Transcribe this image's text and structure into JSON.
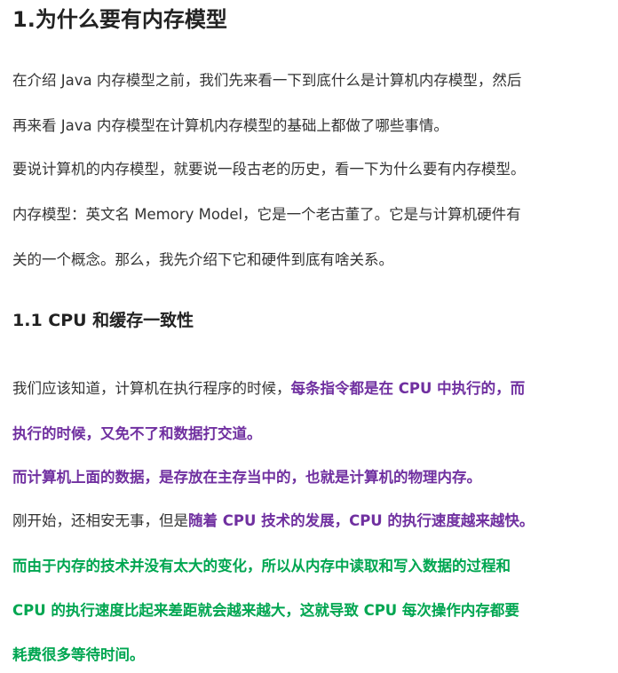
{
  "section": {
    "title": "1.为什么要有内存模型"
  },
  "paragraphs": {
    "p1_l1": "在介绍 Java 内存模型之前，我们先来看一下到底什么是计算机内存模型，然后",
    "p1_l2": "再来看 Java 内存模型在计算机内存模型的基础上都做了哪些事情。",
    "p2": "要说计算机的内存模型，就要说一段古老的历史，看一下为什么要有内存模型。",
    "p3_l1": "内存模型：英文名 Memory Model，它是一个老古董了。它是与计算机硬件有",
    "p3_l2": "关的一个概念。那么，我先介绍下它和硬件到底有啥关系。"
  },
  "subsection": {
    "title": "1.1 CPU  和缓存一致性"
  },
  "sub_paragraphs": {
    "s1_l1_plain": "我们应该知道，计算机在执行程序的时候，",
    "s1_l1_purple": "每条指令都是在 CPU 中执行的，而",
    "s1_l2_purple": "执行的时候，又免不了和数据打交道。",
    "s2_purple": "而计算机上面的数据，是存放在主存当中的，也就是计算机的物理内存。",
    "s3_plain": "刚开始，还相安无事，但是",
    "s3_purple": "随着 CPU 技术的发展，CPU 的执行速度越来越快。",
    "s4_l1_green": "而由于内存的技术并没有太大的变化，所以从内存中读取和写入数据的过程和",
    "s4_l2_green": "CPU 的执行速度比起来差距就会越来越大，这就导致 CPU 每次操作内存都要",
    "s4_l3_green": "耗费很多等待时间。"
  },
  "colors": {
    "text": "#333333",
    "heading": "#222222",
    "emphasis_purple": "#7030a0",
    "emphasis_green": "#00a651"
  }
}
